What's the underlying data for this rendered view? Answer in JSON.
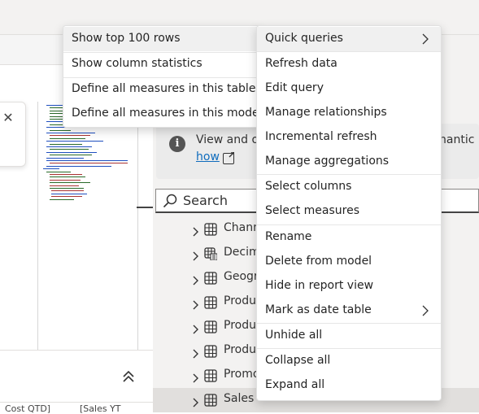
{
  "submenu": {
    "items": [
      "Show top 100 rows",
      "Show column statistics",
      "Define all measures in this table",
      "Define all measures in this model"
    ]
  },
  "menu": {
    "items": [
      {
        "label": "Quick queries",
        "has_submenu": true,
        "highlighted": true
      },
      {
        "label": "Refresh data"
      },
      {
        "label": "Edit query"
      },
      {
        "label": "Manage relationships"
      },
      {
        "label": "Incremental refresh"
      },
      {
        "label": "Manage aggregations"
      },
      {
        "label": "Select columns"
      },
      {
        "label": "Select measures"
      },
      {
        "label": "Rename"
      },
      {
        "label": "Delete from model"
      },
      {
        "label": "Hide in report view"
      },
      {
        "label": "Mark as date table",
        "has_submenu": true
      },
      {
        "label": "Unhide all"
      },
      {
        "label": "Collapse all"
      },
      {
        "label": "Expand all"
      }
    ]
  },
  "info": {
    "text_left": "View and o",
    "text_right": "nantic m",
    "link": "how"
  },
  "search": {
    "placeholder": "Search"
  },
  "tree": {
    "rows": [
      {
        "label": "Chann",
        "icon": "table-icon"
      },
      {
        "label": "Decim",
        "icon": "calculated-table-icon"
      },
      {
        "label": "Geogr",
        "icon": "table-icon"
      },
      {
        "label": "Produ",
        "icon": "table-icon"
      },
      {
        "label": "Produ",
        "icon": "table-icon"
      },
      {
        "label": "Produ",
        "icon": "table-icon"
      },
      {
        "label": "Promo",
        "icon": "table-icon"
      },
      {
        "label": "Sales",
        "icon": "table-icon",
        "selected": true
      }
    ]
  },
  "bottom": {
    "cell1": "Cost QTD]",
    "cell2": "[Sales YT"
  },
  "icons": {
    "close": "close-icon",
    "collapse": "chevron-double-up-icon",
    "info": "info-icon",
    "external": "open-external-icon",
    "search": "search-icon"
  },
  "colors": {
    "link": "#0f6cbd",
    "menu_highlight": "#f0f0f0",
    "selected_row": "#e1dfdd"
  }
}
